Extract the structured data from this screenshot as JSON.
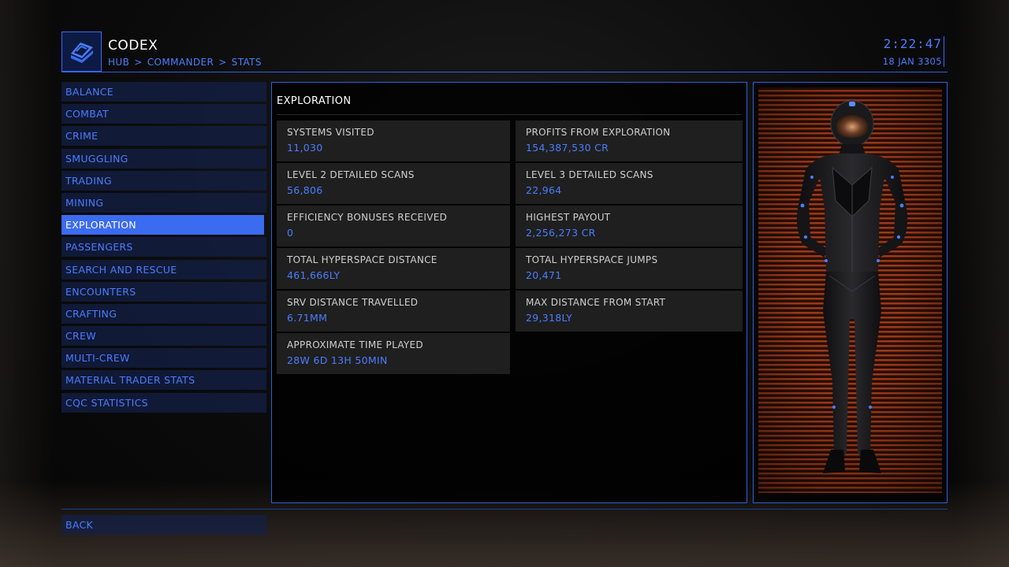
{
  "header": {
    "title": "CODEX",
    "breadcrumb": [
      "HUB",
      "COMMANDER",
      "STATS"
    ],
    "breadcrumb_separator": ">",
    "time": "2:22:47",
    "date": "18 JAN 3305"
  },
  "sidebar": {
    "items": [
      {
        "label": "BALANCE",
        "active": false
      },
      {
        "label": "COMBAT",
        "active": false
      },
      {
        "label": "CRIME",
        "active": false
      },
      {
        "label": "SMUGGLING",
        "active": false
      },
      {
        "label": "TRADING",
        "active": false
      },
      {
        "label": "MINING",
        "active": false
      },
      {
        "label": "EXPLORATION",
        "active": true
      },
      {
        "label": "PASSENGERS",
        "active": false
      },
      {
        "label": "SEARCH AND RESCUE",
        "active": false
      },
      {
        "label": "ENCOUNTERS",
        "active": false
      },
      {
        "label": "CRAFTING",
        "active": false
      },
      {
        "label": "CREW",
        "active": false
      },
      {
        "label": "MULTI-CREW",
        "active": false
      },
      {
        "label": "MATERIAL TRADER STATS",
        "active": false
      },
      {
        "label": "CQC STATISTICS",
        "active": false
      }
    ]
  },
  "section": {
    "title": "EXPLORATION",
    "stats": [
      {
        "label": "SYSTEMS VISITED",
        "value": "11,030"
      },
      {
        "label": "PROFITS FROM EXPLORATION",
        "value": "154,387,530 CR"
      },
      {
        "label": "LEVEL 2 DETAILED SCANS",
        "value": "56,806"
      },
      {
        "label": "LEVEL 3 DETAILED SCANS",
        "value": "22,964"
      },
      {
        "label": "EFFICIENCY BONUSES RECEIVED",
        "value": "0"
      },
      {
        "label": "HIGHEST PAYOUT",
        "value": "2,256,273 CR"
      },
      {
        "label": "TOTAL HYPERSPACE DISTANCE",
        "value": "461,666LY"
      },
      {
        "label": "TOTAL HYPERSPACE JUMPS",
        "value": "20,471"
      },
      {
        "label": "SRV DISTANCE TRAVELLED",
        "value": "6.71MM"
      },
      {
        "label": "MAX DISTANCE FROM START",
        "value": "29,318LY"
      },
      {
        "label": "APPROXIMATE TIME PLAYED",
        "value": "28W 6D 13H 50MIN"
      }
    ]
  },
  "footer": {
    "back_label": "BACK"
  },
  "colors": {
    "accent": "#4a7dff",
    "accent_active": "#3b6bf0",
    "panel_border": "#2f5fd8",
    "portrait_backdrop": "#a3401c"
  },
  "icons": {
    "logo": "codex-book-icon",
    "portrait": "commander-avatar-icon"
  }
}
